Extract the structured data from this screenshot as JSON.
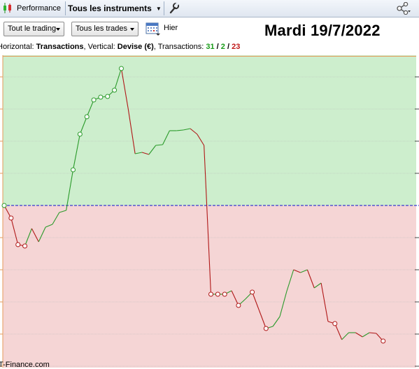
{
  "toolbar": {
    "performance_label": "Performance",
    "instruments_label": "Tous les instruments",
    "icons": [
      "candlestick-icon",
      "wrench-icon",
      "share-icon"
    ]
  },
  "controls": {
    "trading_dropdown": "Tout le trading",
    "trades_dropdown": "Tous les trades",
    "yesterday_label": "Hier",
    "date_title": "Mardi 19/7/2022"
  },
  "info": {
    "horizontal_prefix": "Horizontal: ",
    "horizontal_value": "Transactions",
    "vertical_prefix": ", Vertical: ",
    "vertical_value": "Devise (€)",
    "transactions_prefix": ", Transactions: ",
    "total": "31",
    "sep1": " / ",
    "winners": "2",
    "sep2": " / ",
    "losers": "23"
  },
  "colors": {
    "profit_zone": "#cdeecd",
    "loss_zone": "#f5d5d5",
    "up_line": "#2a9a2a",
    "down_line": "#b01818",
    "zero_line": "#3a3ad0",
    "border": "#e69a5a"
  },
  "footer": "T-Finance.com",
  "chart_data": {
    "type": "line",
    "title": "",
    "xlabel": "Transactions",
    "ylabel": "Devise (€)",
    "grid": true,
    "zero_value": 0,
    "x": [
      0,
      1,
      2,
      3,
      4,
      5,
      6,
      7,
      8,
      9,
      10,
      11,
      12,
      13,
      14,
      15,
      16,
      17,
      18,
      19,
      20,
      21,
      22,
      23,
      24,
      25,
      26,
      27,
      28,
      29,
      30,
      31,
      32,
      33,
      34,
      35,
      36,
      37,
      38,
      39,
      40,
      41,
      42,
      43,
      44,
      45,
      46,
      47,
      48,
      49,
      50,
      51,
      52,
      53,
      54,
      55
    ],
    "values": [
      0,
      -18,
      -56,
      -58,
      -33,
      -52,
      -31,
      -27,
      -10,
      -7,
      51,
      102,
      127,
      151,
      155,
      156,
      165,
      196,
      138,
      74,
      76,
      73,
      86,
      87,
      107,
      107,
      108,
      110,
      102,
      86,
      -127,
      -127,
      -127,
      -122,
      -143,
      -134,
      -124,
      -150,
      -176,
      -173,
      -159,
      -123,
      -92,
      -96,
      -92,
      -118,
      -111,
      -166,
      -169,
      -192,
      -182,
      -182,
      -188,
      -182,
      -183,
      -194
    ],
    "markers": [
      0,
      1,
      2,
      3,
      10,
      11,
      12,
      13,
      14,
      15,
      16,
      17,
      30,
      31,
      32,
      34,
      36,
      38,
      48,
      55
    ]
  }
}
